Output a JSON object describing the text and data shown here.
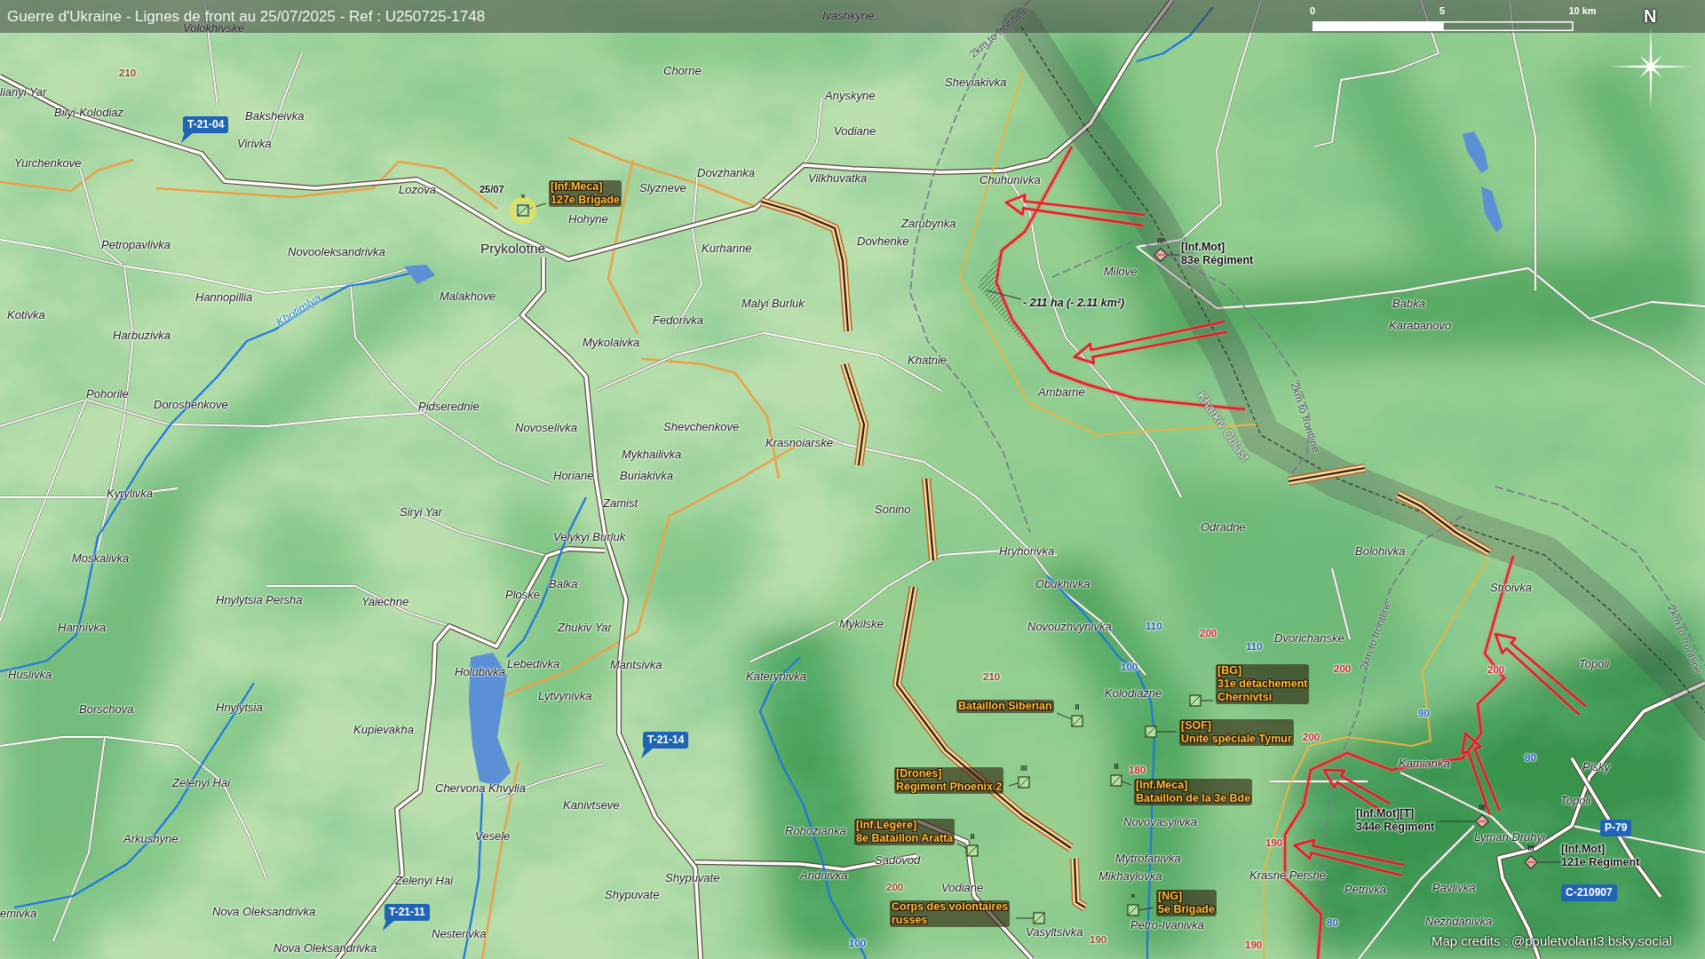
{
  "title": "Guerre d'Ukraine - Lignes de front au 25/07/2025 - Ref : U250725-1748",
  "scale_bar": {
    "labels": [
      "0",
      "5",
      "10 km"
    ]
  },
  "compass": {
    "label": "N"
  },
  "places": [
    {
      "name": "Ivashkyne",
      "kind": "village"
    },
    {
      "name": "Volokhivske",
      "kind": "village"
    },
    {
      "name": "Chorne",
      "kind": "village"
    },
    {
      "name": "Sheviakivka",
      "kind": "village"
    },
    {
      "name": "lianyi Yar",
      "kind": "village"
    },
    {
      "name": "Anyskyne",
      "kind": "village"
    },
    {
      "name": "Bilyi-Kolodiaz",
      "kind": "village"
    },
    {
      "name": "Baksheivka",
      "kind": "village"
    },
    {
      "name": "Vodiane",
      "kind": "village"
    },
    {
      "name": "Virivka",
      "kind": "village"
    },
    {
      "name": "Yurchenkove",
      "kind": "village"
    },
    {
      "name": "Dovzhanka",
      "kind": "village"
    },
    {
      "name": "Vilkhuvatka",
      "kind": "village"
    },
    {
      "name": "Chuhunivka",
      "kind": "village"
    },
    {
      "name": "Lozova",
      "kind": "village"
    },
    {
      "name": "Slyzneve",
      "kind": "village"
    },
    {
      "name": "Hohyne",
      "kind": "village"
    },
    {
      "name": "Zarubynka",
      "kind": "village"
    },
    {
      "name": "Dovhenke",
      "kind": "village"
    },
    {
      "name": "Petropavlivka",
      "kind": "village"
    },
    {
      "name": "Novooleksandrivka",
      "kind": "village"
    },
    {
      "name": "Prykolotne",
      "kind": "town"
    },
    {
      "name": "Kurhanne",
      "kind": "village"
    },
    {
      "name": "Milove",
      "kind": "village"
    },
    {
      "name": "Hannopillia",
      "kind": "village"
    },
    {
      "name": "Malakhove",
      "kind": "village"
    },
    {
      "name": "Malyi Burluk",
      "kind": "village"
    },
    {
      "name": "Babka",
      "kind": "village"
    },
    {
      "name": "Kotivka",
      "kind": "village"
    },
    {
      "name": "Fedorivka",
      "kind": "village"
    },
    {
      "name": "Karabanovo",
      "kind": "village"
    },
    {
      "name": "Harbuzivka",
      "kind": "village"
    },
    {
      "name": "Mykolaivka",
      "kind": "village"
    },
    {
      "name": "Khatnie",
      "kind": "village"
    },
    {
      "name": "Pohorile",
      "kind": "village"
    },
    {
      "name": "Ambarne",
      "kind": "village"
    },
    {
      "name": "Doroshenkove",
      "kind": "village"
    },
    {
      "name": "Pidserednie",
      "kind": "village"
    },
    {
      "name": "Novoselivka",
      "kind": "village"
    },
    {
      "name": "Shevchenkove",
      "kind": "village"
    },
    {
      "name": "Krasnoiarske",
      "kind": "village"
    },
    {
      "name": "Mykhailivka",
      "kind": "village"
    },
    {
      "name": "Horiane",
      "kind": "village"
    },
    {
      "name": "Buriakivka",
      "kind": "village"
    },
    {
      "name": "Kyrylivka",
      "kind": "village"
    },
    {
      "name": "Zamist",
      "kind": "village"
    },
    {
      "name": "Siryi Yar",
      "kind": "village"
    },
    {
      "name": "Sonino",
      "kind": "village"
    },
    {
      "name": "Odradne",
      "kind": "village"
    },
    {
      "name": "Velykyi Burluk",
      "kind": "village"
    },
    {
      "name": "Hryhorivka",
      "kind": "village"
    },
    {
      "name": "Bolohivka",
      "kind": "village"
    },
    {
      "name": "Moskalivka",
      "kind": "village"
    },
    {
      "name": "Balka",
      "kind": "village"
    },
    {
      "name": "Obukhivka",
      "kind": "village"
    },
    {
      "name": "Stroivka",
      "kind": "village"
    },
    {
      "name": "Hnylytsia Persha",
      "kind": "village"
    },
    {
      "name": "Yaiechne",
      "kind": "village"
    },
    {
      "name": "Ploske",
      "kind": "village"
    },
    {
      "name": "Hannivka",
      "kind": "village"
    },
    {
      "name": "Zhukiv Yar",
      "kind": "village"
    },
    {
      "name": "Mykilske",
      "kind": "village"
    },
    {
      "name": "Novouzhvynivka",
      "kind": "village"
    },
    {
      "name": "Dvorichanske",
      "kind": "village"
    },
    {
      "name": "Lebedivka",
      "kind": "village"
    },
    {
      "name": "Mantsivka",
      "kind": "village"
    },
    {
      "name": "Topoli",
      "kind": "village"
    },
    {
      "name": "Huslivka",
      "kind": "village"
    },
    {
      "name": "Holubivka",
      "kind": "village"
    },
    {
      "name": "Katerynivka",
      "kind": "village"
    },
    {
      "name": "Lytvynivka",
      "kind": "village"
    },
    {
      "name": "Kolodiazne",
      "kind": "village"
    },
    {
      "name": "Borschova",
      "kind": "village"
    },
    {
      "name": "Hnylytsia",
      "kind": "village"
    },
    {
      "name": "Kupievakha",
      "kind": "village"
    },
    {
      "name": "Kamianka",
      "kind": "village"
    },
    {
      "name": "Pisky",
      "kind": "village"
    },
    {
      "name": "Zelenyi Hai",
      "kind": "village"
    },
    {
      "name": "Chervona Khvylia",
      "kind": "village"
    },
    {
      "name": "Kanivtseve",
      "kind": "village"
    },
    {
      "name": "Topoli",
      "kind": "village"
    },
    {
      "name": "Novovasylivka",
      "kind": "village"
    },
    {
      "name": "Arkushyne",
      "kind": "village"
    },
    {
      "name": "Vesele",
      "kind": "village"
    },
    {
      "name": "Rohozianka",
      "kind": "village"
    },
    {
      "name": "Lyman Druhyi",
      "kind": "village"
    },
    {
      "name": "Sadovod",
      "kind": "village"
    },
    {
      "name": "Mytrofanivka",
      "kind": "village"
    },
    {
      "name": "Zelenyi Hai",
      "kind": "village"
    },
    {
      "name": "Shypuvate",
      "kind": "village"
    },
    {
      "name": "Andriivka",
      "kind": "village"
    },
    {
      "name": "Mikhaylovka",
      "kind": "village"
    },
    {
      "name": "Krasne Pershe",
      "kind": "village"
    },
    {
      "name": "Vodiane",
      "kind": "village"
    },
    {
      "name": "Petrivka",
      "kind": "village"
    },
    {
      "name": "Pavlivka",
      "kind": "village"
    },
    {
      "name": "Shypuvate",
      "kind": "village"
    },
    {
      "name": "emivka",
      "kind": "village"
    },
    {
      "name": "Nova Oleksandrivka",
      "kind": "village"
    },
    {
      "name": "Petro-Ivanivka",
      "kind": "village"
    },
    {
      "name": "Nezhdanivka",
      "kind": "village"
    },
    {
      "name": "Nesterivka",
      "kind": "village"
    },
    {
      "name": "Vasyltsivka",
      "kind": "village"
    },
    {
      "name": "Nova Oleksandrivka",
      "kind": "village"
    }
  ],
  "river_label": "Khotimlya",
  "line_labels": [
    {
      "text": "2km to frontline",
      "kind": "buffer"
    },
    {
      "text": "Kharkiv Oblast",
      "kind": "region"
    },
    {
      "text": "2km to frontline",
      "kind": "buffer"
    },
    {
      "text": "2km to frontline",
      "kind": "buffer"
    },
    {
      "text": "2km to frontline",
      "kind": "buffer"
    }
  ],
  "number_labels": [
    {
      "text": "210",
      "color": "#8b4a1f"
    },
    {
      "text": "110",
      "color": "#1c5fb8"
    },
    {
      "text": "200",
      "color": "#c62a2a"
    },
    {
      "text": "110",
      "color": "#1c5fb8"
    },
    {
      "text": "100",
      "color": "#1c5fb8"
    },
    {
      "text": "200",
      "color": "#c62a2a"
    },
    {
      "text": "200",
      "color": "#c62a2a"
    },
    {
      "text": "210",
      "color": "#8b4a1f"
    },
    {
      "text": "90",
      "color": "#1c5fb8"
    },
    {
      "text": "200",
      "color": "#c62a2a"
    },
    {
      "text": "80",
      "color": "#1c5fb8"
    },
    {
      "text": "180",
      "color": "#c62a2a"
    },
    {
      "text": "190",
      "color": "#c62a2a"
    },
    {
      "text": "200",
      "color": "#8b4a1f"
    },
    {
      "text": "80",
      "color": "#1c5fb8"
    },
    {
      "text": "100",
      "color": "#1c5fb8"
    },
    {
      "text": "190",
      "color": "#8b4a1f"
    },
    {
      "text": "190",
      "color": "#c62a2a"
    }
  ],
  "road_shields": [
    {
      "text": "T-21-04",
      "kind": "callout"
    },
    {
      "text": "T-21-14",
      "kind": "callout"
    },
    {
      "text": "P-79",
      "kind": "plain"
    },
    {
      "text": "C-210907",
      "kind": "plain"
    },
    {
      "text": "T-21-11",
      "kind": "callout"
    }
  ],
  "units": [
    {
      "kind": "square",
      "echelon": "×",
      "highlighted": true,
      "lines": [
        "[Inf.Meca]",
        "127e Brigade"
      ]
    },
    {
      "kind": "diamond",
      "echelon": "III",
      "highlighted": false,
      "lines": [
        "[Inf.Mot]",
        "83e Régiment"
      ]
    },
    {
      "kind": "square",
      "highlighted": false,
      "lines": [
        "[BG]",
        "31e détachement",
        "Chernivtsi"
      ]
    },
    {
      "kind": "square",
      "echelon": "II",
      "highlighted": false,
      "lines": [
        "Bataillon Siberian"
      ]
    },
    {
      "kind": "square",
      "highlighted": false,
      "lines": [
        "[SOF]",
        "Unité spéciale Tymur"
      ]
    },
    {
      "kind": "square",
      "echelon": "III",
      "highlighted": false,
      "lines": [
        "[Drones]",
        "Régiment Phoenix 2"
      ]
    },
    {
      "kind": "square",
      "echelon": "II",
      "highlighted": false,
      "lines": [
        "[Inf.Meca]",
        "Bataillon de la 3e Bde"
      ]
    },
    {
      "kind": "diamond",
      "echelon": "III",
      "highlighted": false,
      "lines": [
        "[Inf.Mot][T]",
        "344e Régiment"
      ]
    },
    {
      "kind": "square",
      "echelon": "II",
      "highlighted": false,
      "lines": [
        "[Inf.Légère]",
        "8e Bataillon Aratta"
      ]
    },
    {
      "kind": "diamond",
      "echelon": "III",
      "highlighted": false,
      "lines": [
        "[Inf.Mot]",
        "121e Régiment"
      ]
    },
    {
      "kind": "square",
      "echelon": "×",
      "highlighted": false,
      "lines": [
        "[NG]",
        "5e Brigade"
      ]
    },
    {
      "kind": "square",
      "highlighted": false,
      "lines": [
        "Corps des volontaires",
        "russes"
      ]
    }
  ],
  "date_label": "25/07",
  "area_label": "- 211 ha (- 2.11 km²)",
  "credits": "Map credits : @pouletvolant3.bsky.social"
}
